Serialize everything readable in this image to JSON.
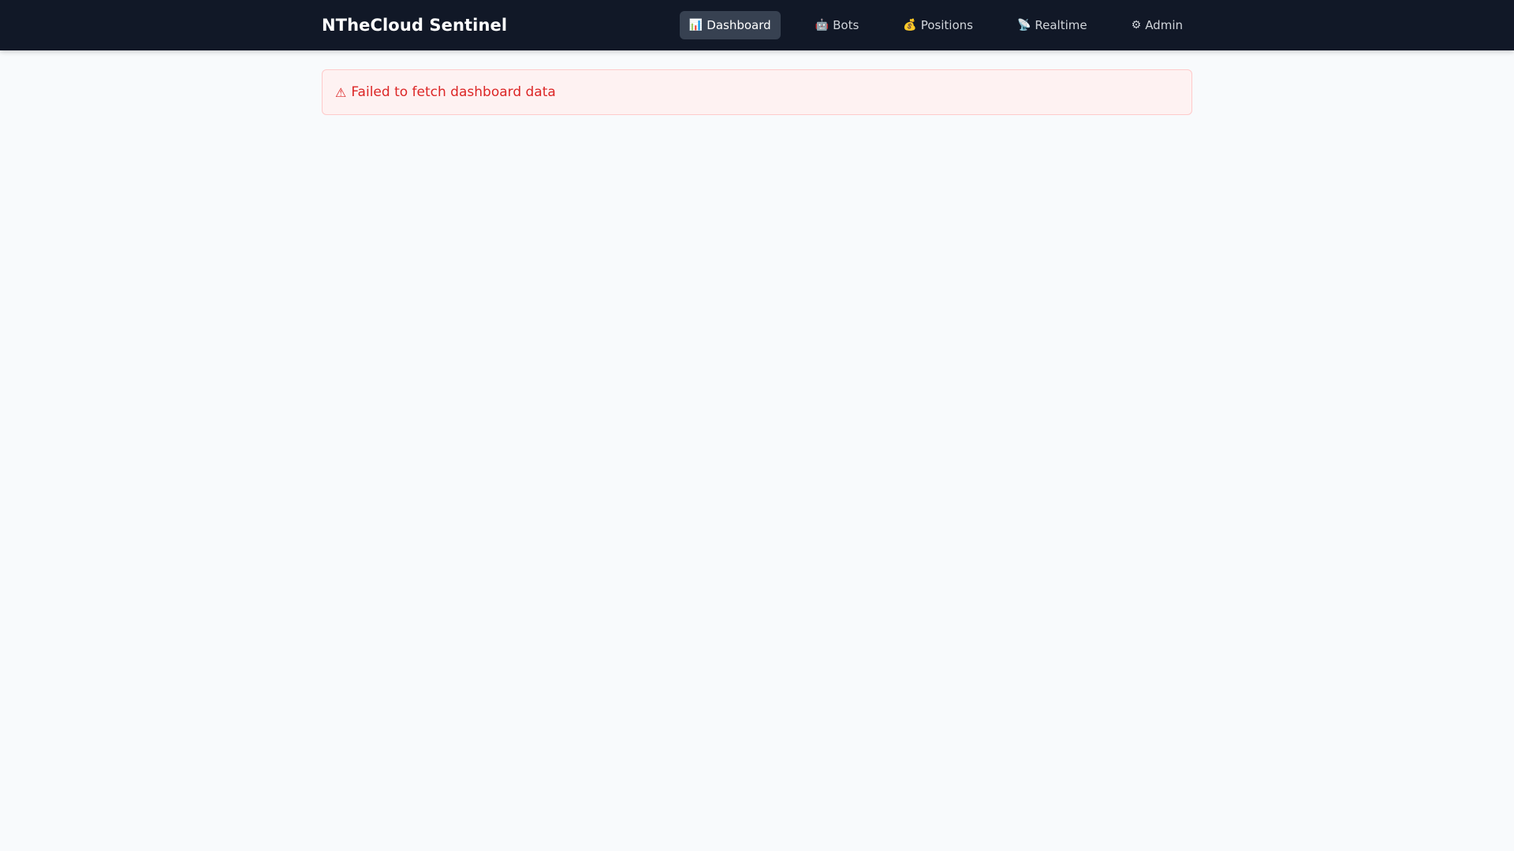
{
  "header": {
    "brand": "NTheCloud Sentinel",
    "nav": [
      {
        "label": "Dashboard",
        "icon": "📊",
        "icon_name": "chart-icon",
        "active": true
      },
      {
        "label": "Bots",
        "icon": "🤖",
        "icon_name": "robot-icon",
        "active": false
      },
      {
        "label": "Positions",
        "icon": "💰",
        "icon_name": "money-bag-icon",
        "active": false
      },
      {
        "label": "Realtime",
        "icon": "📡",
        "icon_name": "satellite-antenna-icon",
        "active": false
      },
      {
        "label": "Admin",
        "icon": "⚙",
        "icon_name": "gear-icon",
        "active": false
      }
    ]
  },
  "alert": {
    "icon": "⚠",
    "icon_name": "warning-icon",
    "message": "Failed to fetch dashboard data"
  },
  "colors": {
    "header_bg": "#111827",
    "active_nav_bg": "#374151",
    "page_bg": "#f8fafc",
    "alert_bg": "#fef2f2",
    "alert_border": "#fecaca",
    "alert_text": "#dc2626"
  }
}
